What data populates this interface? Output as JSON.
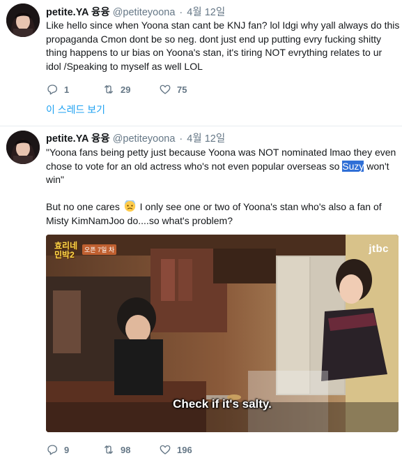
{
  "tweets": [
    {
      "name": "petite.YA 융융",
      "handle": "@petiteyoona",
      "separator": "·",
      "date": "4월 12일",
      "lines": [
        "Like hello since when Yoona stan cant be KNJ fan? lol Idgi why yall always do this",
        "propaganda Cmon dont be so neg. dont just end up putting evry fucking shitty",
        "thing happens to ur bias on Yoona's stan, it's tiring NOT evrything relates to ur",
        "idol /Speaking to myself as well LOL"
      ],
      "replies": "1",
      "retweets": "29",
      "likes": "75",
      "thread_link": "이 스레드 보기"
    },
    {
      "name": "petite.YA 융융",
      "handle": "@petiteyoona",
      "separator": "·",
      "date": "4월 12일",
      "line1": "\"Yoona fans being petty just because Yoona was NOT nominated lmao they even",
      "line2": "chose to vote for an old actress who's not even popular overseas so ",
      "highlight": "Suzy",
      "line2_end": " won't",
      "line3": "win\"",
      "line4_a": "But no one cares ",
      "line4_b": " I only see one or two of Yoona's stan who's also a  fan of",
      "line5": "Misty KimNamJoo do....so what's problem?",
      "media": {
        "caption": "Check if it's salty.",
        "watermark": "jtbc",
        "show_logo": "효리네\n민박2",
        "show_tag": "오픈 7일 차"
      },
      "replies": "9",
      "retweets": "98",
      "likes": "196"
    }
  ],
  "icons": {
    "reply": "reply-icon",
    "retweet": "retweet-icon",
    "like": "heart-icon",
    "emoji": "anxious-face-emoji"
  },
  "colors": {
    "link": "#1da1f2",
    "muted": "#657786",
    "highlight": "#2f6fd6"
  }
}
